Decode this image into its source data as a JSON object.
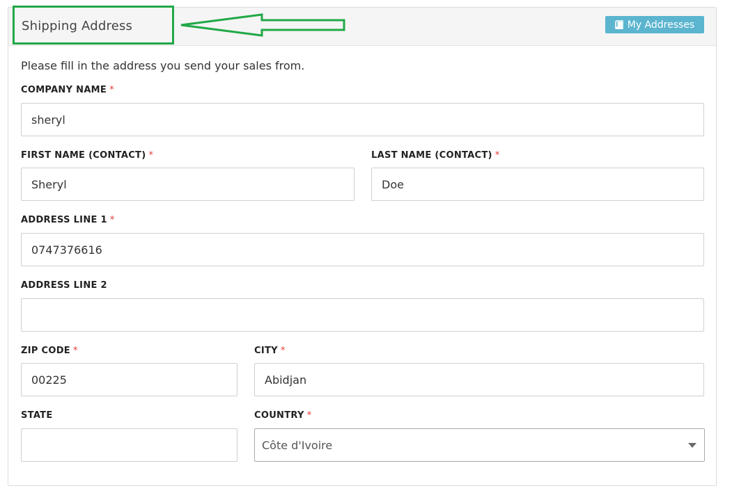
{
  "header": {
    "title": "Shipping Address",
    "addresses_button": "My Addresses",
    "addresses_icon": "address-book-icon",
    "button_color": "#5bb5cf"
  },
  "annotation": {
    "highlight_color": "#22a847"
  },
  "form": {
    "intro": "Please fill in the address you send your sales from.",
    "required_mark": "*",
    "company_name": {
      "label": "COMPANY NAME",
      "value": "sheryl",
      "required": true
    },
    "first_name": {
      "label": "FIRST NAME (CONTACT)",
      "value": "Sheryl",
      "required": true
    },
    "last_name": {
      "label": "LAST NAME (CONTACT)",
      "value": "Doe",
      "required": true
    },
    "address_line_1": {
      "label": "ADDRESS LINE 1",
      "value": "0747376616",
      "required": true
    },
    "address_line_2": {
      "label": "ADDRESS LINE 2",
      "value": "",
      "required": false
    },
    "zip_code": {
      "label": "ZIP CODE",
      "value": "00225",
      "required": true
    },
    "city": {
      "label": "CITY",
      "value": "Abidjan",
      "required": true
    },
    "state": {
      "label": "STATE",
      "value": "",
      "required": false
    },
    "country": {
      "label": "COUNTRY",
      "value": "Côte d'Ivoire",
      "required": true
    }
  }
}
